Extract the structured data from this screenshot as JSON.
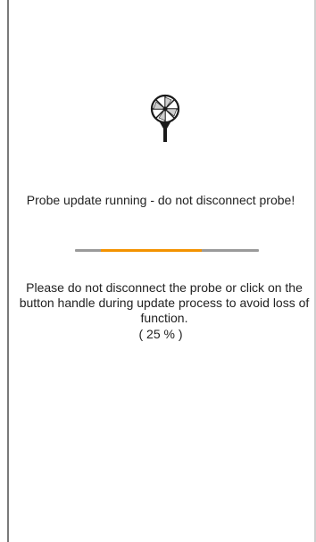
{
  "status_text": "Probe update running - do not disconnect probe!",
  "message": "Please do not disconnect the probe or click on the button handle during update process to avoid loss of function.",
  "progress": {
    "percent": 25,
    "label": "( 25 % )"
  },
  "icon": "probe-vane-icon",
  "colors": {
    "accent": "#f39200",
    "track": "#9a9a9a",
    "text": "#222222"
  }
}
